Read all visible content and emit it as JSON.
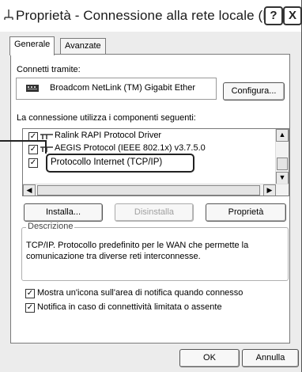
{
  "window": {
    "title": "Proprietà - Connessione alla rete locale (LAN)",
    "help_button": "?",
    "close_button": "X"
  },
  "tabs": [
    {
      "label": "Generale",
      "active": true
    },
    {
      "label": "Avanzate",
      "active": false
    }
  ],
  "connect_using": {
    "label": "Connetti tramite:",
    "adapter": "Broadcom NetLink (TM) Gigabit Ether",
    "configure_button": "Configura..."
  },
  "components": {
    "label": "La connessione utilizza i componenti seguenti:",
    "items": [
      {
        "label": "Ralink RAPI Protocol Driver",
        "checked": true
      },
      {
        "label": "AEGIS Protocol (IEEE 802.1x) v3.7.5.0",
        "checked": true
      },
      {
        "label": "Protocollo Internet (TCP/IP)",
        "checked": true,
        "selected": true
      }
    ]
  },
  "buttons": {
    "install": "Installa...",
    "uninstall": "Disinstalla",
    "properties": "Proprietà"
  },
  "description": {
    "title": "Descrizione",
    "text": "TCP/IP. Protocollo predefinito per le WAN che permette la comunicazione tra diverse reti interconnesse."
  },
  "options": [
    {
      "label": "Mostra un'icona sull'area di notifica quando connesso",
      "checked": true
    },
    {
      "label": "Notifica in caso di connettività limitata o assente",
      "checked": true
    }
  ],
  "footer": {
    "ok": "OK",
    "cancel": "Annulla"
  },
  "colors": {
    "dialog_bg": "#ececec",
    "panel_bg": "#ffffff",
    "border": "#7a7a7a",
    "disabled_text": "#a0a0a0"
  }
}
